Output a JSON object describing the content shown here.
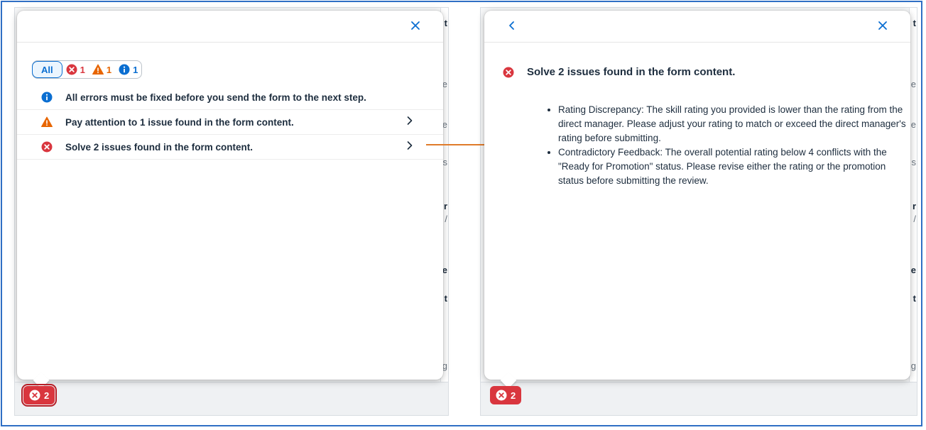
{
  "left_panel": {
    "close_label": "Close",
    "filter": {
      "all_label": "All",
      "error_count": "1",
      "warning_count": "1",
      "info_count": "1"
    },
    "messages": [
      {
        "type": "info",
        "text": "All errors must be fixed before you send the form to the next step.",
        "navigable": false
      },
      {
        "type": "warning",
        "text": "Pay attention to 1 issue found in the form content.",
        "navigable": true
      },
      {
        "type": "error",
        "text": "Solve 2 issues found in the form content.",
        "navigable": true
      }
    ],
    "footer_badge_count": "2"
  },
  "right_panel": {
    "detail_title": "Solve 2 issues found in the form content.",
    "detail_items": [
      "Rating Discrepancy: The skill rating you provided is lower than the rating from the direct manager. Please adjust your rating to match or exceed the direct manager's rating before submitting.",
      "Contradictory Feedback: The overall potential rating below 4 conflicts with the \"Ready for Promotion\" status. Please revise either the rating or the promotion status before submitting the review."
    ],
    "footer_badge_count": "2"
  },
  "background_fragments": [
    "t",
    "e",
    "e",
    "s",
    "r",
    "/",
    "e",
    "t",
    "g"
  ],
  "colors": {
    "error": "#d9363e",
    "warning": "#e76500",
    "info": "#0a6ed1",
    "connector": "#e07b2a",
    "frame": "#2f6fc4"
  },
  "icons": {
    "close": "close-icon",
    "back": "chevron-left-icon",
    "navigate": "chevron-right-icon",
    "error": "error-circle-icon",
    "warning": "warning-triangle-icon",
    "info": "info-circle-icon"
  }
}
